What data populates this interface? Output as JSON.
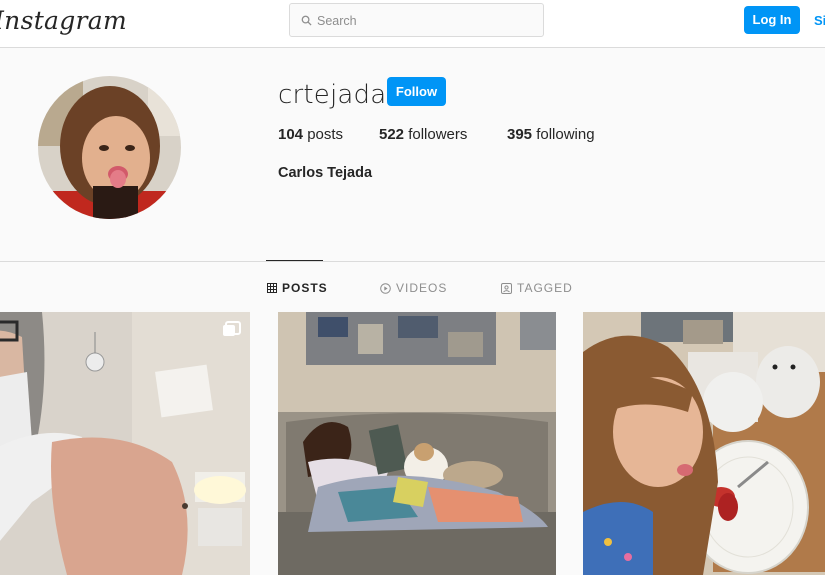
{
  "header": {
    "logo_text": "Instagram",
    "search_placeholder": "Search",
    "login_label": "Log In",
    "signup_label": "Sign Up"
  },
  "profile": {
    "username": "crtejada",
    "follow_label": "Follow",
    "posts_count": "104",
    "posts_label": "posts",
    "followers_count": "522",
    "followers_label": "followers",
    "following_count": "395",
    "following_label": "following",
    "full_name": "Carlos Tejada"
  },
  "tabs": [
    {
      "label": "POSTS",
      "icon": "grid-icon",
      "active": true
    },
    {
      "label": "VIDEOS",
      "icon": "play-icon",
      "active": false
    },
    {
      "label": "TAGGED",
      "icon": "tag-icon",
      "active": false
    }
  ],
  "posts": [
    {
      "alt": "man in mask showing shoulder",
      "multi": true
    },
    {
      "alt": "girl on couch with dog",
      "multi": false
    },
    {
      "alt": "girl licking plate",
      "multi": false
    }
  ],
  "colors": {
    "accent": "#0095f6",
    "border": "#dbdbdb",
    "muted": "#8e8e8e"
  }
}
